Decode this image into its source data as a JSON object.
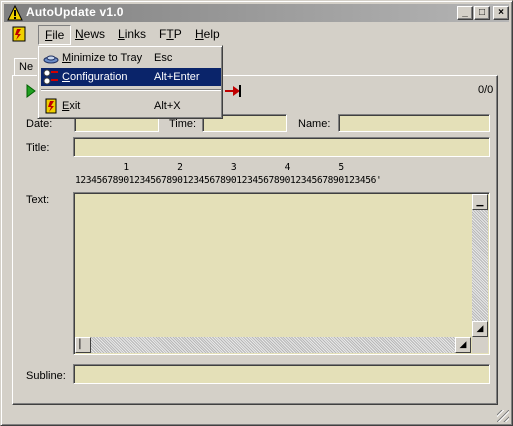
{
  "window": {
    "title": "AutoUpdate v1.0",
    "controls": {
      "minimize": "_",
      "maximize": "□",
      "close": "×"
    }
  },
  "menubar": {
    "items": [
      {
        "label": "File",
        "underline": "F",
        "rest": "ile"
      },
      {
        "label": "News",
        "underline": "N",
        "rest": "ews"
      },
      {
        "label": "Links",
        "underline": "L",
        "rest": "inks"
      },
      {
        "label": "FTP",
        "prefix": "F",
        "underline": "T",
        "rest": "P"
      },
      {
        "label": "Help",
        "underline": "H",
        "rest": "elp"
      }
    ]
  },
  "file_menu": {
    "items": [
      {
        "icon": "tray-icon",
        "underline": "M",
        "rest": "inimize to Tray",
        "shortcut": "Esc"
      },
      {
        "icon": "configuration-icon",
        "underline": "C",
        "rest": "onfiguration",
        "shortcut": "Alt+Enter",
        "highlighted": true
      },
      {
        "icon": "exit-icon",
        "underline": "E",
        "rest": "xit",
        "shortcut": "Alt+X"
      }
    ]
  },
  "tab": {
    "label": "Ne"
  },
  "toolbar": {
    "counter": "0/0"
  },
  "form": {
    "date_label": "Date:",
    "time_label": "Time:",
    "name_label": "Name:",
    "title_label": "Title:",
    "text_label": "Text:",
    "subline_label": "Subline:",
    "date_value": "",
    "time_value": "",
    "name_value": "",
    "title_value": "",
    "text_value": "",
    "subline_value": ""
  },
  "ruler": {
    "tens": "         1         2         3         4         5",
    "units": "12345678901234567890123456789012345678901234567890123456'"
  },
  "colors": {
    "field_bg": "#e4e0b8",
    "menu_highlight": "#0a246a",
    "face": "#d4d0c8"
  }
}
